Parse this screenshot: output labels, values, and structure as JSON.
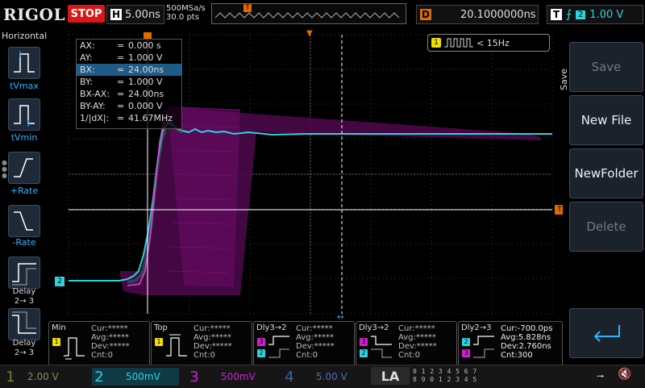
{
  "topbar": {
    "logo": "RIGOL",
    "run_state": "STOP",
    "timebase_key": "H",
    "timebase_value": "5.00ns",
    "sample_rate": "500MSa/s",
    "memory_depth": "30.0 pts",
    "delay_key": "D",
    "delay_value": "20.1000000ns",
    "trigger_key": "T",
    "trigger_channel": "2",
    "trigger_level": "1.00 V",
    "trigger_position_marker": "T"
  },
  "left_panel": {
    "title": "Horizontal",
    "items": [
      {
        "label": "tVmax",
        "icon": "tvmax-icon"
      },
      {
        "label": "tVmin",
        "icon": "tvmin-icon"
      },
      {
        "label": "+Rate",
        "icon": "rise-rate-icon"
      },
      {
        "label": "-Rate",
        "icon": "fall-rate-icon"
      },
      {
        "label": "Delay↑\n2→ 3",
        "label_line1": "Delay",
        "label_line2": "2→ 3",
        "icon": "delay-rise-icon"
      },
      {
        "label_line1": "Delay",
        "label_line2": "2→ 3",
        "icon": "delay-fall-icon"
      }
    ]
  },
  "cursor_box": {
    "rows": [
      {
        "label": "AX:",
        "eq": "=",
        "value": "0.000 s"
      },
      {
        "label": "AY:",
        "eq": "=",
        "value": "1.000 V"
      },
      {
        "label": "BX:",
        "eq": "=",
        "value": "24.00ns"
      },
      {
        "label": "BY:",
        "eq": "=",
        "value": "1.000 V"
      },
      {
        "label": "BX-AX:",
        "eq": "=",
        "value": "24.00ns"
      },
      {
        "label": "BY-AY:",
        "eq": "=",
        "value": "0.000 V"
      },
      {
        "label": "1/|dX|:",
        "eq": "=",
        "value": "41.67MHz"
      }
    ]
  },
  "frequency": {
    "channel": "1",
    "value": "< 15Hz"
  },
  "right_menu": {
    "side_label": "Save",
    "buttons": [
      {
        "label": "Save",
        "enabled": false
      },
      {
        "label": "New File",
        "enabled": true
      },
      {
        "label": "NewFolder",
        "enabled": true
      },
      {
        "label": "Delete",
        "enabled": false
      }
    ]
  },
  "markers": {
    "ch2_marker": "2",
    "trigger_level_marker": "T"
  },
  "measurements": [
    {
      "title": "Min",
      "channel": "1",
      "cur": "Cur:*****",
      "avg": "Avg:*****",
      "dev": "Dev:*****",
      "cnt": "Cnt:0"
    },
    {
      "title": "Top",
      "channel": "1",
      "cur": "Cur:*****",
      "avg": "Avg:*****",
      "dev": "Dev:*****",
      "cnt": "Cnt:0"
    },
    {
      "title": "Dly3→2",
      "channel": "3",
      "channel_b": "2",
      "cur": "Cur:*****",
      "avg": "Avg:*****",
      "dev": "Dev:*****",
      "cnt": "Cnt:0"
    },
    {
      "title": "Dly3→2",
      "channel": "3",
      "channel_b": "2",
      "cur": "Cur:*****",
      "avg": "Avg:*****",
      "dev": "Dev:*****",
      "cnt": "Cnt:0"
    },
    {
      "title": "Dly2→3",
      "channel": "2",
      "channel_b": "3",
      "cur": "Cur:-700.0ps",
      "avg": "Avg:5.828ns",
      "dev": "Dev:2.760ns",
      "cnt": "Cnt:300"
    }
  ],
  "channels": [
    {
      "num": "1",
      "scale": "2.00 V",
      "color": "#7a7a30"
    },
    {
      "num": "2",
      "scale": "500mV",
      "color": "#29d4e0"
    },
    {
      "num": "3",
      "scale": "500mV",
      "color": "#d020d0"
    },
    {
      "num": "4",
      "scale": "5.00 V",
      "color": "#3a5fa8"
    }
  ],
  "la": {
    "label": "LA",
    "grid_top": "░░░░ ░░░░",
    "row1": "0 1 2 3   4 5 6 7",
    "row2": "8 9 0 1   2 3 4 5"
  },
  "colors": {
    "ch1": "#f0e000",
    "ch2": "#29d4e0",
    "ch3": "#d020d0",
    "trigger": "#e06a00",
    "accent": "#29b6ff"
  }
}
